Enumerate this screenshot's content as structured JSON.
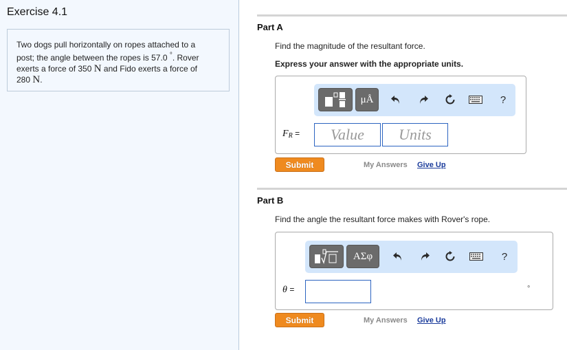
{
  "exercise": {
    "title": "Exercise 4.1",
    "problem_parts": {
      "line1": "Two dogs pull horizontally on ropes attached to a",
      "line2a": "post; the angle between the ropes is 57.0 ",
      "degree_symbol": "°",
      "line2b": ". Rover",
      "line3a": "exerts a force of 350 ",
      "unit_N": "N",
      "line3b": " and Fido exerts a force of",
      "line4a": "280 ",
      "line4b": "."
    }
  },
  "parts": [
    {
      "title": "Part A",
      "prompt": "Find the magnitude of the resultant force.",
      "instruction": "Express your answer with the appropriate units.",
      "toolbar": {
        "template_button_icon": "fraction-template-icon",
        "symbol_button_label": "μÅ",
        "undo_icon": "undo-icon",
        "redo_icon": "redo-icon",
        "reset_icon": "reset-icon",
        "keyboard_icon": "keyboard-icon",
        "help_label": "?"
      },
      "variable_label": "F",
      "variable_sub": "R",
      "equals": "=",
      "value_placeholder": "Value",
      "units_placeholder": "Units",
      "submit_label": "Submit",
      "my_answers_label": "My Answers",
      "give_up_label": "Give Up"
    },
    {
      "title": "Part B",
      "prompt": "Find the angle the resultant force makes with Rover's rope.",
      "toolbar": {
        "template_button_icon": "root-template-icon",
        "symbol_button_label": "ΑΣφ",
        "undo_icon": "undo-icon",
        "redo_icon": "redo-icon",
        "reset_icon": "reset-icon",
        "keyboard_icon": "keyboard-icon",
        "help_label": "?"
      },
      "variable_label": "θ",
      "equals": "=",
      "answer_value": "",
      "unit_suffix": "°",
      "submit_label": "Submit",
      "my_answers_label": "My Answers",
      "give_up_label": "Give Up"
    }
  ],
  "colors": {
    "submit": "#ef8a1f",
    "link": "#1a3b9b",
    "toolbar_bg": "#d3e6fb",
    "input_border": "#2b63c0",
    "left_panel_bg": "#f3f8fe"
  }
}
